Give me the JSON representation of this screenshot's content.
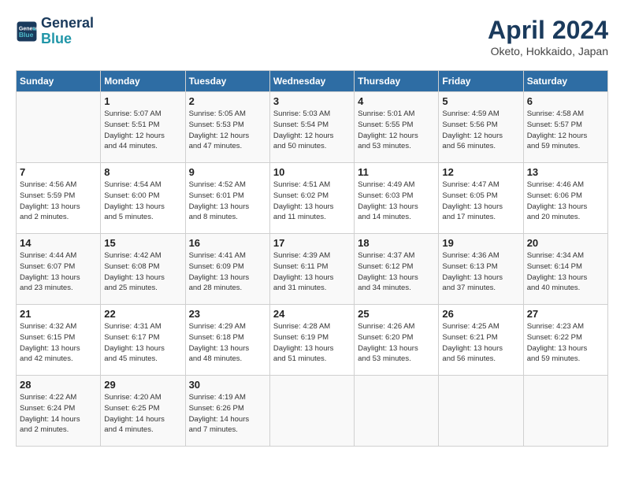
{
  "header": {
    "logo_line1": "General",
    "logo_line2": "Blue",
    "title": "April 2024",
    "location": "Oketo, Hokkaido, Japan"
  },
  "days_of_week": [
    "Sunday",
    "Monday",
    "Tuesday",
    "Wednesday",
    "Thursday",
    "Friday",
    "Saturday"
  ],
  "weeks": [
    [
      {
        "day": "",
        "info": ""
      },
      {
        "day": "1",
        "info": "Sunrise: 5:07 AM\nSunset: 5:51 PM\nDaylight: 12 hours\nand 44 minutes."
      },
      {
        "day": "2",
        "info": "Sunrise: 5:05 AM\nSunset: 5:53 PM\nDaylight: 12 hours\nand 47 minutes."
      },
      {
        "day": "3",
        "info": "Sunrise: 5:03 AM\nSunset: 5:54 PM\nDaylight: 12 hours\nand 50 minutes."
      },
      {
        "day": "4",
        "info": "Sunrise: 5:01 AM\nSunset: 5:55 PM\nDaylight: 12 hours\nand 53 minutes."
      },
      {
        "day": "5",
        "info": "Sunrise: 4:59 AM\nSunset: 5:56 PM\nDaylight: 12 hours\nand 56 minutes."
      },
      {
        "day": "6",
        "info": "Sunrise: 4:58 AM\nSunset: 5:57 PM\nDaylight: 12 hours\nand 59 minutes."
      }
    ],
    [
      {
        "day": "7",
        "info": "Sunrise: 4:56 AM\nSunset: 5:59 PM\nDaylight: 13 hours\nand 2 minutes."
      },
      {
        "day": "8",
        "info": "Sunrise: 4:54 AM\nSunset: 6:00 PM\nDaylight: 13 hours\nand 5 minutes."
      },
      {
        "day": "9",
        "info": "Sunrise: 4:52 AM\nSunset: 6:01 PM\nDaylight: 13 hours\nand 8 minutes."
      },
      {
        "day": "10",
        "info": "Sunrise: 4:51 AM\nSunset: 6:02 PM\nDaylight: 13 hours\nand 11 minutes."
      },
      {
        "day": "11",
        "info": "Sunrise: 4:49 AM\nSunset: 6:03 PM\nDaylight: 13 hours\nand 14 minutes."
      },
      {
        "day": "12",
        "info": "Sunrise: 4:47 AM\nSunset: 6:05 PM\nDaylight: 13 hours\nand 17 minutes."
      },
      {
        "day": "13",
        "info": "Sunrise: 4:46 AM\nSunset: 6:06 PM\nDaylight: 13 hours\nand 20 minutes."
      }
    ],
    [
      {
        "day": "14",
        "info": "Sunrise: 4:44 AM\nSunset: 6:07 PM\nDaylight: 13 hours\nand 23 minutes."
      },
      {
        "day": "15",
        "info": "Sunrise: 4:42 AM\nSunset: 6:08 PM\nDaylight: 13 hours\nand 25 minutes."
      },
      {
        "day": "16",
        "info": "Sunrise: 4:41 AM\nSunset: 6:09 PM\nDaylight: 13 hours\nand 28 minutes."
      },
      {
        "day": "17",
        "info": "Sunrise: 4:39 AM\nSunset: 6:11 PM\nDaylight: 13 hours\nand 31 minutes."
      },
      {
        "day": "18",
        "info": "Sunrise: 4:37 AM\nSunset: 6:12 PM\nDaylight: 13 hours\nand 34 minutes."
      },
      {
        "day": "19",
        "info": "Sunrise: 4:36 AM\nSunset: 6:13 PM\nDaylight: 13 hours\nand 37 minutes."
      },
      {
        "day": "20",
        "info": "Sunrise: 4:34 AM\nSunset: 6:14 PM\nDaylight: 13 hours\nand 40 minutes."
      }
    ],
    [
      {
        "day": "21",
        "info": "Sunrise: 4:32 AM\nSunset: 6:15 PM\nDaylight: 13 hours\nand 42 minutes."
      },
      {
        "day": "22",
        "info": "Sunrise: 4:31 AM\nSunset: 6:17 PM\nDaylight: 13 hours\nand 45 minutes."
      },
      {
        "day": "23",
        "info": "Sunrise: 4:29 AM\nSunset: 6:18 PM\nDaylight: 13 hours\nand 48 minutes."
      },
      {
        "day": "24",
        "info": "Sunrise: 4:28 AM\nSunset: 6:19 PM\nDaylight: 13 hours\nand 51 minutes."
      },
      {
        "day": "25",
        "info": "Sunrise: 4:26 AM\nSunset: 6:20 PM\nDaylight: 13 hours\nand 53 minutes."
      },
      {
        "day": "26",
        "info": "Sunrise: 4:25 AM\nSunset: 6:21 PM\nDaylight: 13 hours\nand 56 minutes."
      },
      {
        "day": "27",
        "info": "Sunrise: 4:23 AM\nSunset: 6:22 PM\nDaylight: 13 hours\nand 59 minutes."
      }
    ],
    [
      {
        "day": "28",
        "info": "Sunrise: 4:22 AM\nSunset: 6:24 PM\nDaylight: 14 hours\nand 2 minutes."
      },
      {
        "day": "29",
        "info": "Sunrise: 4:20 AM\nSunset: 6:25 PM\nDaylight: 14 hours\nand 4 minutes."
      },
      {
        "day": "30",
        "info": "Sunrise: 4:19 AM\nSunset: 6:26 PM\nDaylight: 14 hours\nand 7 minutes."
      },
      {
        "day": "",
        "info": ""
      },
      {
        "day": "",
        "info": ""
      },
      {
        "day": "",
        "info": ""
      },
      {
        "day": "",
        "info": ""
      }
    ]
  ]
}
